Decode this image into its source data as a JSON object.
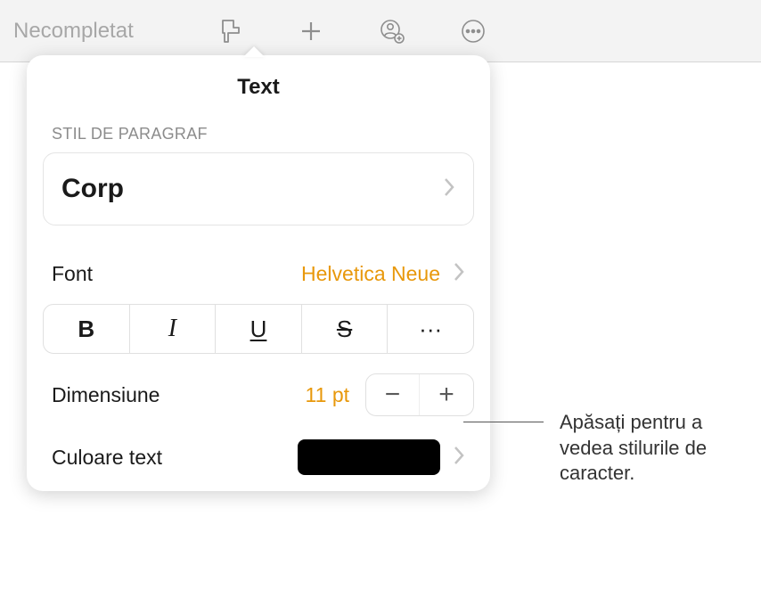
{
  "toolbar": {
    "title": "Necompletat"
  },
  "panel": {
    "title": "Text",
    "paragraph_section_label": "STIL DE PARAGRAF",
    "paragraph_style": "Corp",
    "font_label": "Font",
    "font_value": "Helvetica Neue",
    "style_buttons": {
      "bold": "B",
      "italic": "I",
      "underline": "U",
      "strike": "S",
      "more": "···"
    },
    "size_label": "Dimensiune",
    "size_value": "11 pt",
    "stepper": {
      "minus": "−",
      "plus": "+"
    },
    "color_label": "Culoare text",
    "color_value": "#000000"
  },
  "callout": {
    "text": "Apăsați pentru a vedea stilurile de caracter."
  }
}
